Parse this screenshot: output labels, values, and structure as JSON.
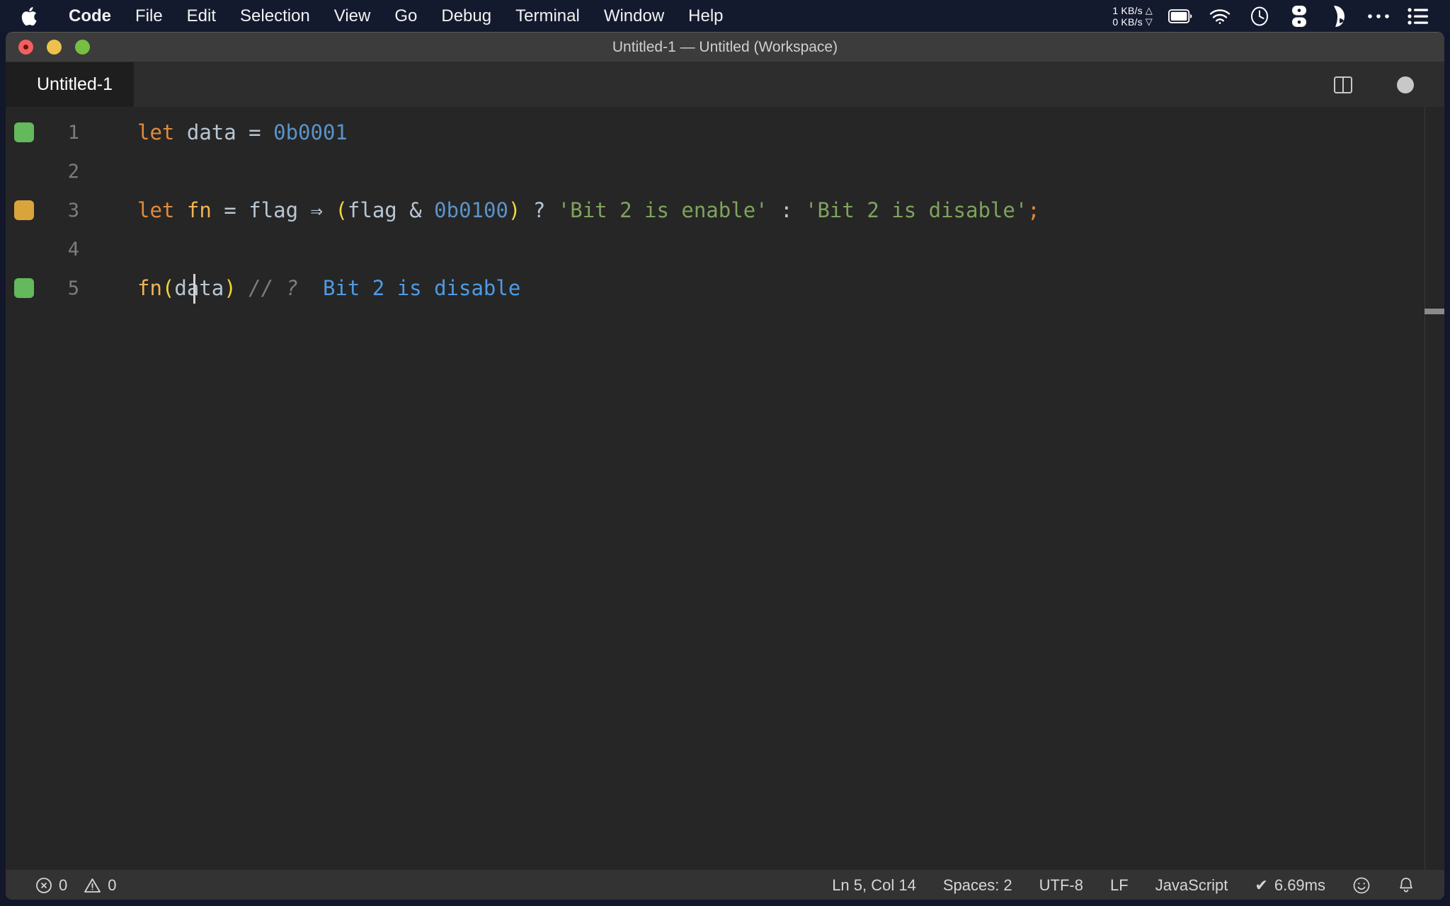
{
  "menubar": {
    "apple_icon": "apple-logo-icon",
    "items": [
      {
        "label": "Code",
        "bold": true
      },
      {
        "label": "File",
        "bold": false
      },
      {
        "label": "Edit",
        "bold": false
      },
      {
        "label": "Selection",
        "bold": false
      },
      {
        "label": "View",
        "bold": false
      },
      {
        "label": "Go",
        "bold": false
      },
      {
        "label": "Debug",
        "bold": false
      },
      {
        "label": "Terminal",
        "bold": false
      },
      {
        "label": "Window",
        "bold": false
      },
      {
        "label": "Help",
        "bold": false
      }
    ],
    "network": {
      "up": "1 KB/s",
      "down": "0 KB/s",
      "up_arrow": "△",
      "down_arrow": "▽"
    },
    "tray": [
      "battery-icon",
      "wifi-icon",
      "clock-icon",
      "itsycal-icon",
      "bartender-icon",
      "ellipsis-icon",
      "control-center-icon"
    ]
  },
  "window": {
    "title": "Untitled-1 — Untitled (Workspace)",
    "traffic_lights": [
      "close-button",
      "minimize-button",
      "maximize-button"
    ]
  },
  "tabs": {
    "active_tab": "Untitled-1",
    "actions": [
      "split-editor-icon",
      "unsaved-dot-icon"
    ]
  },
  "editor": {
    "lines": [
      {
        "number": "1",
        "marker": "#63b95c",
        "tokens": [
          {
            "text": "let",
            "style": "t-kw"
          },
          {
            "text": " ",
            "style": "t-plain"
          },
          {
            "text": "data",
            "style": "t-var"
          },
          {
            "text": " ",
            "style": "t-plain"
          },
          {
            "text": "=",
            "style": "t-op"
          },
          {
            "text": " ",
            "style": "t-plain"
          },
          {
            "text": "0b0001",
            "style": "t-num"
          }
        ]
      },
      {
        "number": "2",
        "marker": "",
        "tokens": []
      },
      {
        "number": "3",
        "marker": "#d9a43a",
        "tokens": [
          {
            "text": "let",
            "style": "t-kw"
          },
          {
            "text": " ",
            "style": "t-plain"
          },
          {
            "text": "fn",
            "style": "t-fn"
          },
          {
            "text": " ",
            "style": "t-plain"
          },
          {
            "text": "=",
            "style": "t-op"
          },
          {
            "text": " ",
            "style": "t-plain"
          },
          {
            "text": "flag",
            "style": "t-var"
          },
          {
            "text": " ",
            "style": "t-plain"
          },
          {
            "text": "⇒",
            "style": "t-op"
          },
          {
            "text": " ",
            "style": "t-plain"
          },
          {
            "text": "(",
            "style": "t-bracket"
          },
          {
            "text": "flag",
            "style": "t-var"
          },
          {
            "text": " ",
            "style": "t-plain"
          },
          {
            "text": "&",
            "style": "t-op"
          },
          {
            "text": " ",
            "style": "t-plain"
          },
          {
            "text": "0b0100",
            "style": "t-num"
          },
          {
            "text": ")",
            "style": "t-bracket"
          },
          {
            "text": " ",
            "style": "t-plain"
          },
          {
            "text": "?",
            "style": "t-op"
          },
          {
            "text": " ",
            "style": "t-plain"
          },
          {
            "text": "'Bit 2 is enable'",
            "style": "t-str"
          },
          {
            "text": " ",
            "style": "t-plain"
          },
          {
            "text": ":",
            "style": "t-op"
          },
          {
            "text": " ",
            "style": "t-plain"
          },
          {
            "text": "'Bit 2 is disable'",
            "style": "t-str"
          },
          {
            "text": ";",
            "style": "t-punct"
          }
        ]
      },
      {
        "number": "4",
        "marker": "",
        "tokens": []
      },
      {
        "number": "5",
        "marker": "#63b95c",
        "tokens": [
          {
            "text": "fn",
            "style": "t-fn"
          },
          {
            "text": "(",
            "style": "t-bracket"
          },
          {
            "text": "data",
            "style": "t-var"
          },
          {
            "text": ")",
            "style": "t-bracket"
          },
          {
            "text": " ",
            "style": "t-plain"
          },
          {
            "text": "//",
            "style": "t-comment"
          },
          {
            "text": " ",
            "style": "t-plain"
          },
          {
            "text": "?",
            "style": "t-comment"
          },
          {
            "text": "  ",
            "style": "t-plain"
          },
          {
            "text": "Bit 2 is disable",
            "style": "t-out"
          }
        ]
      }
    ]
  },
  "statusbar": {
    "errors_icon": "error-circle-icon",
    "errors": "0",
    "warnings_icon": "warning-triangle-icon",
    "warnings": "0",
    "cursor_position": "Ln 5, Col 14",
    "indentation": "Spaces: 2",
    "encoding": "UTF-8",
    "eol": "LF",
    "language": "JavaScript",
    "runtime_check": "✔",
    "runtime": "6.69ms",
    "feedback_icon": "smiley-icon",
    "notifications_icon": "bell-icon"
  }
}
